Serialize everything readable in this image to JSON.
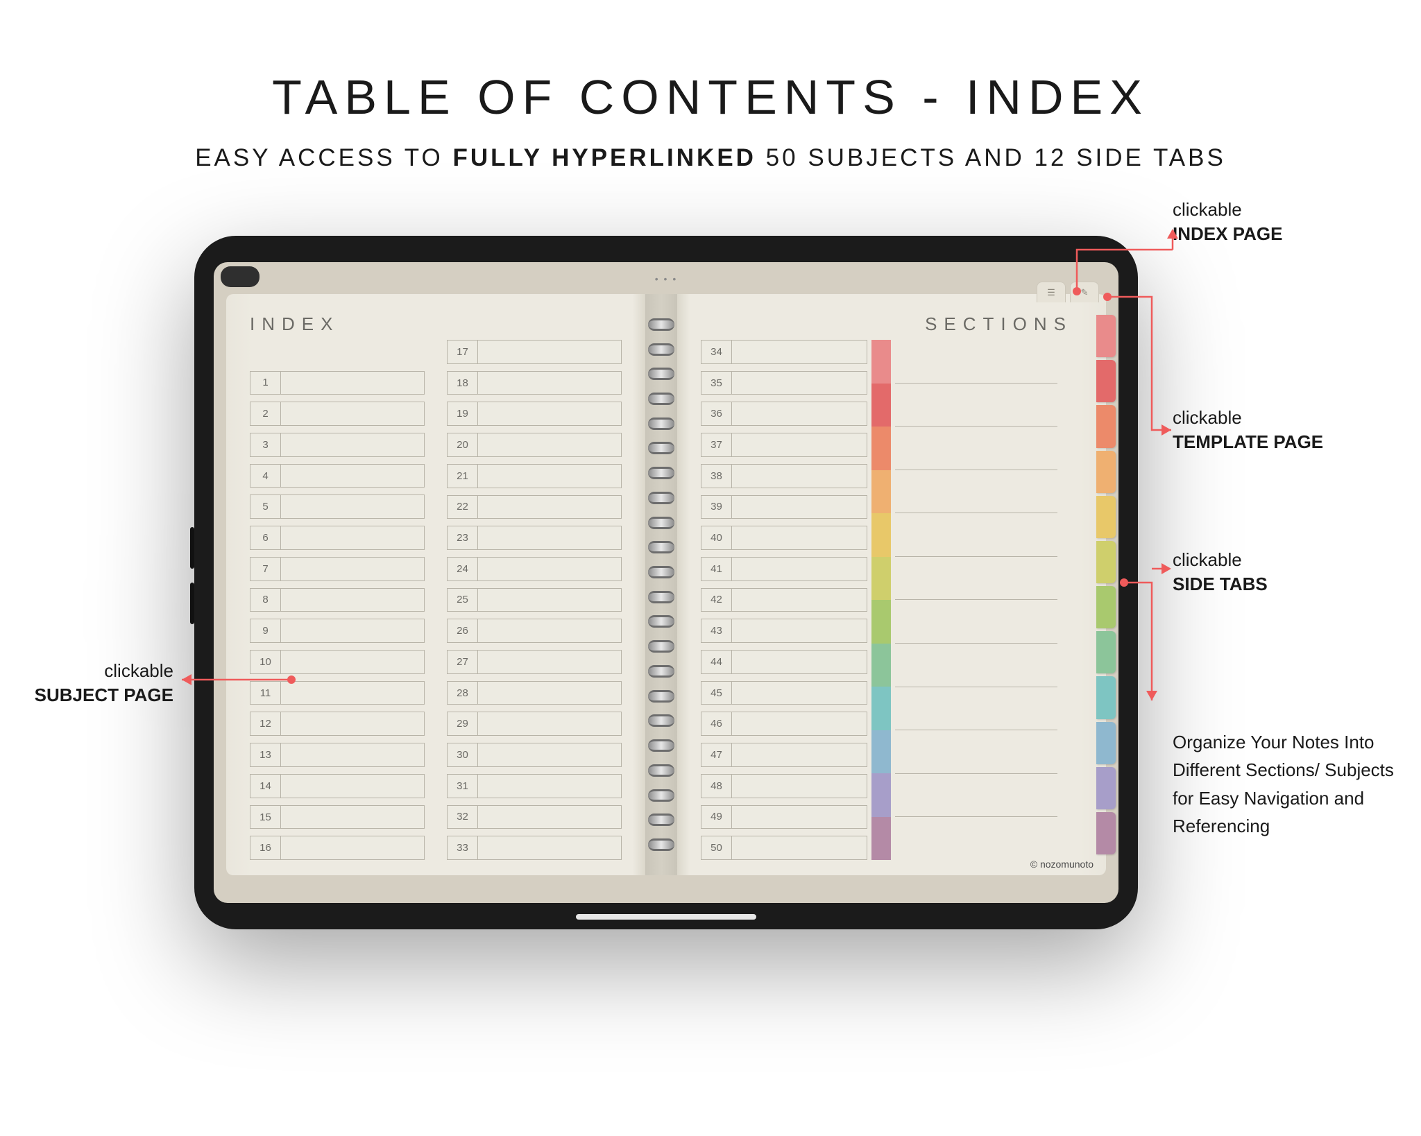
{
  "headline": {
    "title": "TABLE OF CONTENTS - INDEX",
    "sub_pre": "EASY ACCESS TO ",
    "sub_bold": "FULLY HYPERLINKED",
    "sub_post": " 50 SUBJECTS AND 12 SIDE TABS"
  },
  "notebook": {
    "index_label": "INDEX",
    "sections_label": "SECTIONS",
    "corner_tabs": {
      "index": "☰",
      "template": "✎"
    },
    "credit": "© nozomunoto",
    "columns": [
      {
        "start": 1,
        "end": 16,
        "pad_top": true
      },
      {
        "start": 17,
        "end": 33,
        "pad_top": false
      },
      {
        "start": 34,
        "end": 50,
        "pad_top": false
      }
    ],
    "section_rows": 12,
    "tab_colors": [
      "#e98b8b",
      "#e36a6a",
      "#ec8a6a",
      "#efb071",
      "#e8c869",
      "#cfcf6c",
      "#a9c96e",
      "#8cc59a",
      "#7ec5c2",
      "#8fb8cf",
      "#a79ec9",
      "#b48aa6"
    ]
  },
  "callouts": {
    "subject": {
      "light": "clickable",
      "bold": "SUBJECT PAGE"
    },
    "index": {
      "light": "clickable",
      "bold": "INDEX PAGE"
    },
    "template": {
      "light": "clickable",
      "bold": "TEMPLATE PAGE"
    },
    "tabs": {
      "light": "clickable",
      "bold": "SIDE TABS"
    },
    "note": "Organize Your Notes Into Different Sections/ Subjects for Easy Navigation and Referencing"
  }
}
